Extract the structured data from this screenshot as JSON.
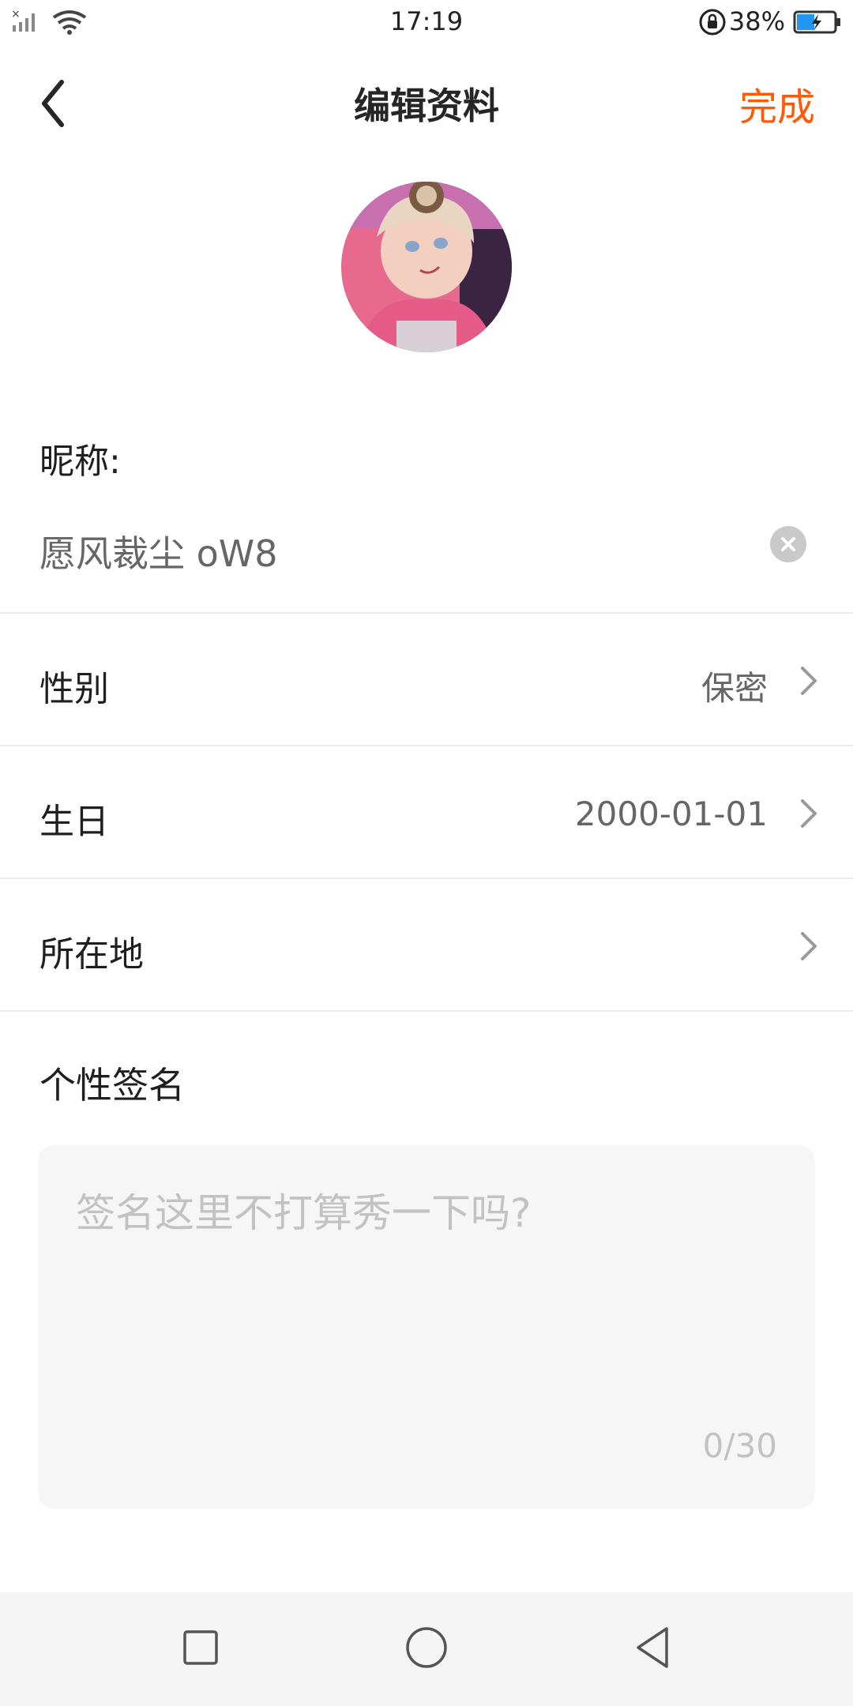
{
  "status_bar": {
    "time": "17:19",
    "battery_percent": "38%",
    "icons": [
      "no-sim-signal-icon",
      "wifi-icon",
      "rotation-lock-icon",
      "battery-charging-icon"
    ]
  },
  "header": {
    "title": "编辑资料",
    "done_label": "完成",
    "back_icon": "chevron-left-icon"
  },
  "avatar": {
    "icon": "avatar-image"
  },
  "nickname": {
    "label": "昵称:",
    "value": "愿风裁尘 oW8",
    "clear_icon": "clear-circle-icon"
  },
  "rows": [
    {
      "label": "性别",
      "value": "保密"
    },
    {
      "label": "生日",
      "value": "2000-01-01"
    },
    {
      "label": "所在地",
      "value": ""
    }
  ],
  "signature": {
    "label": "个性签名",
    "placeholder": "签名这里不打算秀一下吗?",
    "counter": "0/30"
  },
  "nav_bar": {
    "buttons": [
      "recents-square-icon",
      "home-circle-icon",
      "back-triangle-icon"
    ]
  },
  "colors": {
    "accent": "#ff5a0a",
    "battery": "#2196f3"
  }
}
